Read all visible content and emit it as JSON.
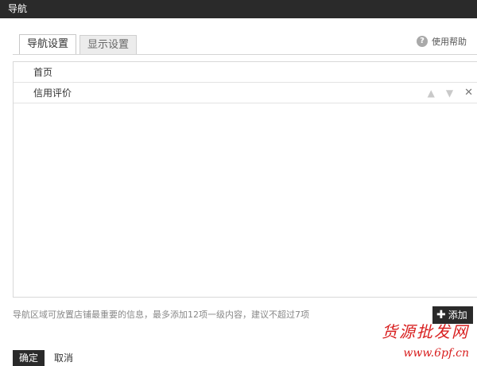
{
  "window": {
    "title": "导航"
  },
  "tabs": [
    {
      "label": "导航设置",
      "active": true
    },
    {
      "label": "显示设置",
      "active": false
    }
  ],
  "help": {
    "icon": "help-icon",
    "label": "使用帮助"
  },
  "nav_items": [
    {
      "label": "首页"
    },
    {
      "label": "信用评价",
      "actions": [
        "move-up-icon",
        "move-down-icon",
        "close-icon"
      ]
    }
  ],
  "hint": "导航区域可放置店铺最重要的信息，最多添加12项一级内容，建议不超过7项",
  "buttons": {
    "add": "添加",
    "ok": "确定",
    "cancel": "取消"
  },
  "watermark": {
    "line1": "货源批发网",
    "line2": "www.6pf.cn"
  }
}
